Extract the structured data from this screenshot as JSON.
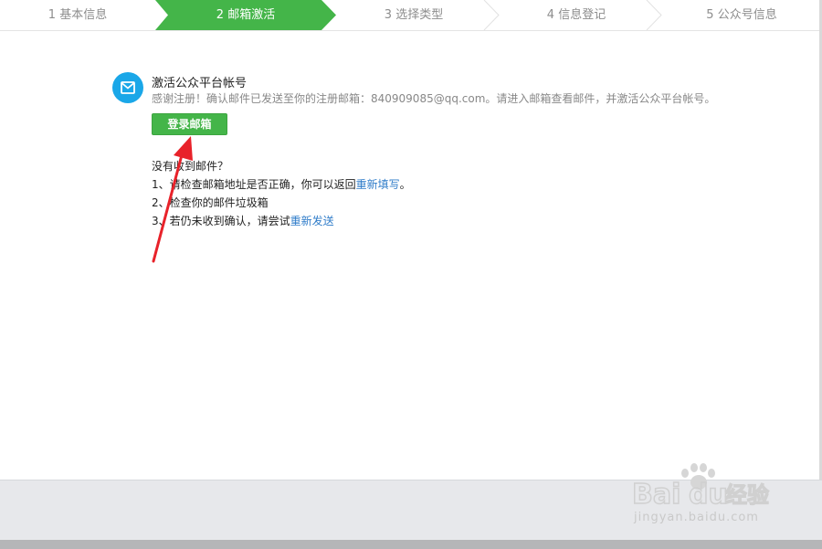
{
  "steps": [
    {
      "label": "1 基本信息",
      "active": false
    },
    {
      "label": "2 邮箱激活",
      "active": true
    },
    {
      "label": "3 选择类型",
      "active": false
    },
    {
      "label": "4 信息登记",
      "active": false
    },
    {
      "label": "5 公众号信息",
      "active": false
    }
  ],
  "colors": {
    "accent": "#44b549",
    "link": "#2f7cc9",
    "mail_icon": "#1aa7e8",
    "arrow": "#e8222a"
  },
  "activate": {
    "icon": "mail-icon",
    "title": "激活公众平台帐号",
    "description": "感谢注册！确认邮件已发送至你的注册邮箱：840909085@qq.com。请进入邮箱查看邮件，并激活公众平台帐号。",
    "login_button": "登录邮箱"
  },
  "help": {
    "heading": "没有收到邮件？",
    "item1_text": "1、请检查邮箱地址是否正确，你可以返回",
    "item1_link": "重新填写",
    "item1_end": "。",
    "item2_text": "2、检查你的邮件垃圾箱",
    "item3_text": "3、若仍未收到确认，请尝试",
    "item3_link": "重新发送"
  },
  "watermark": {
    "logo_text": "Baidu经验",
    "url": "jingyan.baidu.com"
  }
}
